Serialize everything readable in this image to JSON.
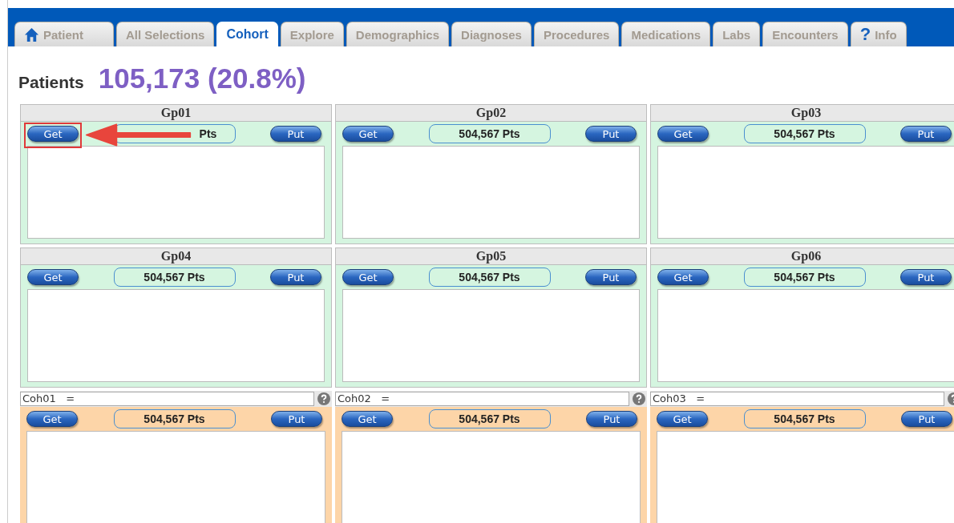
{
  "tabs": [
    {
      "label": "Patient",
      "kind": "home",
      "selected": false
    },
    {
      "label": "All Selections",
      "selected": false
    },
    {
      "label": "Cohort",
      "selected": true
    },
    {
      "label": "Explore",
      "selected": false
    },
    {
      "label": "Demographics",
      "selected": false
    },
    {
      "label": "Diagnoses",
      "selected": false
    },
    {
      "label": "Procedures",
      "selected": false
    },
    {
      "label": "Medications",
      "selected": false
    },
    {
      "label": "Labs",
      "selected": false
    },
    {
      "label": "Encounters",
      "selected": false
    },
    {
      "label": "Info",
      "kind": "help",
      "glyph": "?",
      "selected": false
    }
  ],
  "summary": {
    "label": "Patients",
    "value": "105,173 (20.8%)"
  },
  "groups": [
    {
      "title": "Gp01",
      "get": "Get",
      "count": "Pts",
      "put": "Put",
      "annotated": true
    },
    {
      "title": "Gp02",
      "get": "Get",
      "count": "504,567 Pts",
      "put": "Put",
      "annotated": false
    },
    {
      "title": "Gp03",
      "get": "Get",
      "count": "504,567 Pts",
      "put": "Put",
      "annotated": false
    },
    {
      "title": "Gp04",
      "get": "Get",
      "count": "504,567 Pts",
      "put": "Put",
      "annotated": false
    },
    {
      "title": "Gp05",
      "get": "Get",
      "count": "504,567 Pts",
      "put": "Put",
      "annotated": false
    },
    {
      "title": "Gp06",
      "get": "Get",
      "count": "504,567 Pts",
      "put": "Put",
      "annotated": false
    }
  ],
  "cohorts": [
    {
      "label": "Coh01   =",
      "get": "Get",
      "count": "504,567 Pts",
      "put": "Put"
    },
    {
      "label": "Coh02   =",
      "get": "Get",
      "count": "504,567 Pts",
      "put": "Put"
    },
    {
      "label": "Coh03   =",
      "get": "Get",
      "count": "504,567 Pts",
      "put": "Put"
    }
  ]
}
